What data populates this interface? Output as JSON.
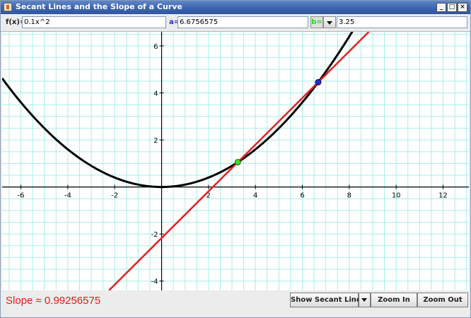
{
  "window": {
    "title": "Secant Lines and the Slope of a Curve"
  },
  "toolbar": {
    "fx_label": "f(x)=",
    "fx_value": "0.1x^2",
    "a_label": "a=",
    "a_value": "6.6756575",
    "b_label": "b=",
    "b_value": "3.25"
  },
  "graph": {
    "x_tick_labels": [
      "-6",
      "-4",
      "-2",
      "2",
      "4",
      "6",
      "8",
      "10",
      "12"
    ],
    "y_tick_labels": [
      "-4",
      "-2",
      "2",
      "4",
      "6"
    ],
    "colors": {
      "curve": "#000000",
      "secant": "#e81f1f",
      "point_a": "#1c2fd6",
      "point_b": "#3ee01b",
      "grid": "#a8ecec"
    }
  },
  "chart_data": {
    "type": "line",
    "xlim": [
      -6.8,
      13.1
    ],
    "ylim": [
      -4.4,
      6.6
    ],
    "grid": true,
    "series": [
      {
        "expression": "0.1x^2",
        "samples": [
          [
            -6.8,
            4.624
          ],
          [
            -4,
            1.6
          ],
          [
            -2,
            0.4
          ],
          [
            0,
            0
          ],
          [
            2,
            0.4
          ],
          [
            4,
            1.6
          ],
          [
            6,
            3.6
          ],
          [
            8.5,
            7.225
          ]
        ]
      },
      {
        "kind": "secant",
        "through": [
          [
            3.25,
            1.05625
          ],
          [
            6.6756575,
            4.4564
          ]
        ],
        "slope": 0.99256575
      }
    ],
    "points": [
      {
        "name": "a",
        "x": 6.6756575,
        "y": 4.4564
      },
      {
        "name": "b",
        "x": 3.25,
        "y": 1.05625
      }
    ]
  },
  "footer": {
    "slope_text": "Slope ≈ 0.99256575",
    "show_secant_label": "Show Secant Line",
    "zoom_in_label": "Zoom In",
    "zoom_out_label": "Zoom Out"
  }
}
